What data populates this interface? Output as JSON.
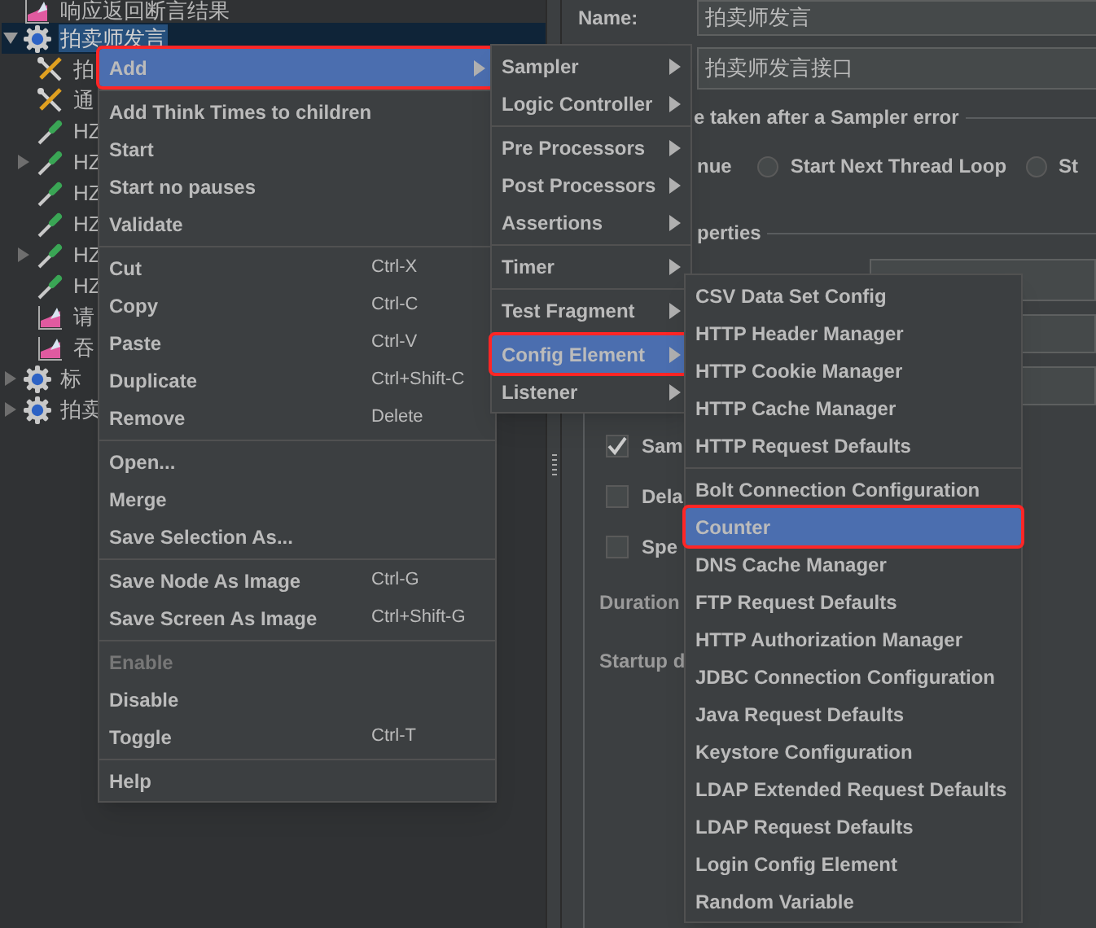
{
  "tree": [
    {
      "label": "响应返回断言结果",
      "kind": "listener",
      "selected": false
    },
    {
      "label": "拍卖师发言",
      "kind": "gear",
      "expanded": true,
      "selected": true,
      "children": [
        {
          "label": "拍",
          "kind": "tool",
          "selected": false
        },
        {
          "label": "通",
          "kind": "tool",
          "selected": false
        },
        {
          "label": "HZ",
          "kind": "sampler",
          "selected": false
        },
        {
          "label": "HZ",
          "kind": "sampler",
          "expanded": false,
          "selected": false
        },
        {
          "label": "HZ",
          "kind": "sampler",
          "selected": false
        },
        {
          "label": "HZ",
          "kind": "sampler",
          "selected": false
        },
        {
          "label": "HZ",
          "kind": "sampler",
          "expanded": false,
          "selected": false
        },
        {
          "label": "HZ",
          "kind": "sampler",
          "selected": false
        },
        {
          "label": "请",
          "kind": "listener",
          "selected": false
        },
        {
          "label": "吞",
          "kind": "listener",
          "selected": false
        }
      ]
    },
    {
      "label": "标",
      "kind": "gear",
      "expanded": false,
      "selected": false
    },
    {
      "label": "拍卖",
      "kind": "gear",
      "expanded": false,
      "selected": false
    }
  ],
  "name_field": {
    "label": "Name:",
    "value": "拍卖师发言"
  },
  "comments_field": {
    "value": "拍卖师发言接口"
  },
  "error_action": {
    "legend": "e taken after a Sampler error",
    "first_option_label": "nue",
    "options": [
      {
        "label": "Start Next Thread Loop",
        "selected": false
      },
      {
        "label": "St",
        "selected": false
      }
    ]
  },
  "properties": {
    "legend": "perties",
    "checkboxes": [
      {
        "label": "Sam",
        "checked": true
      },
      {
        "label": "Dela",
        "checked": false
      },
      {
        "label": "Spe",
        "checked": false
      }
    ],
    "labels": [
      "Duration",
      "Startup d"
    ]
  },
  "menus": [
    {
      "items": [
        {
          "kind": "item",
          "label": "Add",
          "submenu": true,
          "selected": true,
          "disabled": false
        },
        {
          "kind": "separator"
        },
        {
          "kind": "item",
          "label": "Add Think Times to children",
          "selected": false,
          "disabled": false
        },
        {
          "kind": "item",
          "label": "Start",
          "selected": false,
          "disabled": false
        },
        {
          "kind": "item",
          "label": "Start no pauses",
          "selected": false,
          "disabled": false
        },
        {
          "kind": "item",
          "label": "Validate",
          "selected": false,
          "disabled": false
        },
        {
          "kind": "separator"
        },
        {
          "kind": "item",
          "label": "Cut",
          "shortcut": "Ctrl-X",
          "selected": false,
          "disabled": false
        },
        {
          "kind": "item",
          "label": "Copy",
          "shortcut": "Ctrl-C",
          "selected": false,
          "disabled": false
        },
        {
          "kind": "item",
          "label": "Paste",
          "shortcut": "Ctrl-V",
          "selected": false,
          "disabled": false
        },
        {
          "kind": "item",
          "label": "Duplicate",
          "shortcut": "Ctrl+Shift-C",
          "selected": false,
          "disabled": false
        },
        {
          "kind": "item",
          "label": "Remove",
          "shortcut": "Delete",
          "selected": false,
          "disabled": false
        },
        {
          "kind": "separator"
        },
        {
          "kind": "item",
          "label": "Open...",
          "selected": false,
          "disabled": false
        },
        {
          "kind": "item",
          "label": "Merge",
          "selected": false,
          "disabled": false
        },
        {
          "kind": "item",
          "label": "Save Selection As...",
          "selected": false,
          "disabled": false
        },
        {
          "kind": "separator"
        },
        {
          "kind": "item",
          "label": "Save Node As Image",
          "shortcut": "Ctrl-G",
          "selected": false,
          "disabled": false
        },
        {
          "kind": "item",
          "label": "Save Screen As Image",
          "shortcut": "Ctrl+Shift-G",
          "selected": false,
          "disabled": false
        },
        {
          "kind": "separator"
        },
        {
          "kind": "item",
          "label": "Enable",
          "selected": false,
          "disabled": true
        },
        {
          "kind": "item",
          "label": "Disable",
          "selected": false,
          "disabled": false
        },
        {
          "kind": "item",
          "label": "Toggle",
          "shortcut": "Ctrl-T",
          "selected": false,
          "disabled": false
        },
        {
          "kind": "separator"
        },
        {
          "kind": "item",
          "label": "Help",
          "selected": false,
          "disabled": false
        }
      ]
    },
    {
      "items": [
        {
          "kind": "item",
          "label": "Sampler",
          "submenu": true,
          "selected": false
        },
        {
          "kind": "item",
          "label": "Logic Controller",
          "submenu": true,
          "selected": false
        },
        {
          "kind": "separator"
        },
        {
          "kind": "item",
          "label": "Pre Processors",
          "submenu": true,
          "selected": false
        },
        {
          "kind": "item",
          "label": "Post Processors",
          "submenu": true,
          "selected": false
        },
        {
          "kind": "item",
          "label": "Assertions",
          "submenu": true,
          "selected": false
        },
        {
          "kind": "separator"
        },
        {
          "kind": "item",
          "label": "Timer",
          "submenu": true,
          "selected": false
        },
        {
          "kind": "separator"
        },
        {
          "kind": "item",
          "label": "Test Fragment",
          "submenu": true,
          "selected": false
        },
        {
          "kind": "separator"
        },
        {
          "kind": "item",
          "label": "Config Element",
          "submenu": true,
          "selected": true
        },
        {
          "kind": "item",
          "label": "Listener",
          "submenu": true,
          "selected": false
        }
      ]
    },
    {
      "items": [
        {
          "kind": "item",
          "label": "CSV Data Set Config",
          "selected": false
        },
        {
          "kind": "item",
          "label": "HTTP Header Manager",
          "selected": false
        },
        {
          "kind": "item",
          "label": "HTTP Cookie Manager",
          "selected": false
        },
        {
          "kind": "item",
          "label": "HTTP Cache Manager",
          "selected": false
        },
        {
          "kind": "item",
          "label": "HTTP Request Defaults",
          "selected": false
        },
        {
          "kind": "separator"
        },
        {
          "kind": "item",
          "label": "Bolt Connection Configuration",
          "selected": false
        },
        {
          "kind": "item",
          "label": "Counter",
          "selected": true
        },
        {
          "kind": "item",
          "label": "DNS Cache Manager",
          "selected": false
        },
        {
          "kind": "item",
          "label": "FTP Request Defaults",
          "selected": false
        },
        {
          "kind": "item",
          "label": "HTTP Authorization Manager",
          "selected": false
        },
        {
          "kind": "item",
          "label": "JDBC Connection Configuration",
          "selected": false
        },
        {
          "kind": "item",
          "label": "Java Request Defaults",
          "selected": false
        },
        {
          "kind": "item",
          "label": "Keystore Configuration",
          "selected": false
        },
        {
          "kind": "item",
          "label": "LDAP Extended Request Defaults",
          "selected": false
        },
        {
          "kind": "item",
          "label": "LDAP Request Defaults",
          "selected": false
        },
        {
          "kind": "item",
          "label": "Login Config Element",
          "selected": false
        },
        {
          "kind": "item",
          "label": "Random Variable",
          "selected": false
        }
      ]
    }
  ]
}
